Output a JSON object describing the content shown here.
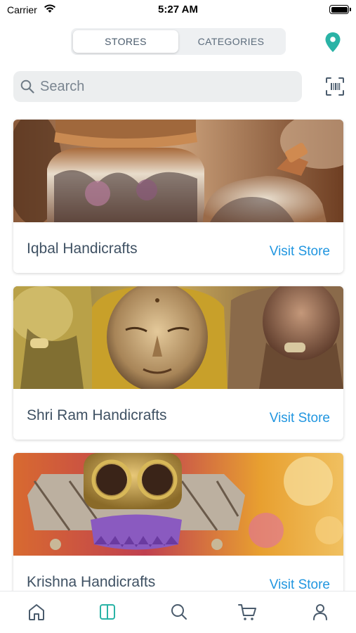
{
  "status_bar": {
    "carrier": "Carrier",
    "time": "5:27 AM"
  },
  "segmented": {
    "tabs": [
      {
        "label": "STORES",
        "active": true
      },
      {
        "label": "CATEGORIES",
        "active": false
      }
    ]
  },
  "search": {
    "placeholder": "Search",
    "value": ""
  },
  "stores": [
    {
      "name": "Iqbal Handicrafts",
      "link": "Visit Store",
      "image": "painted-copper-vases"
    },
    {
      "name": "Shri Ram Handicrafts",
      "link": "Visit Store",
      "image": "brass-face-sculptures"
    },
    {
      "name": "Krishna Handicrafts",
      "link": "Visit Store",
      "image": "owl-earrings-jewelry"
    }
  ],
  "tabbar": {
    "items": [
      "home-icon",
      "stores-icon",
      "search-icon",
      "cart-icon",
      "profile-icon"
    ],
    "active": "stores-icon"
  },
  "colors": {
    "accent": "#2ab3a6",
    "link": "#2196e0",
    "text": "#3f5163",
    "icon": "#4a5b6c"
  }
}
